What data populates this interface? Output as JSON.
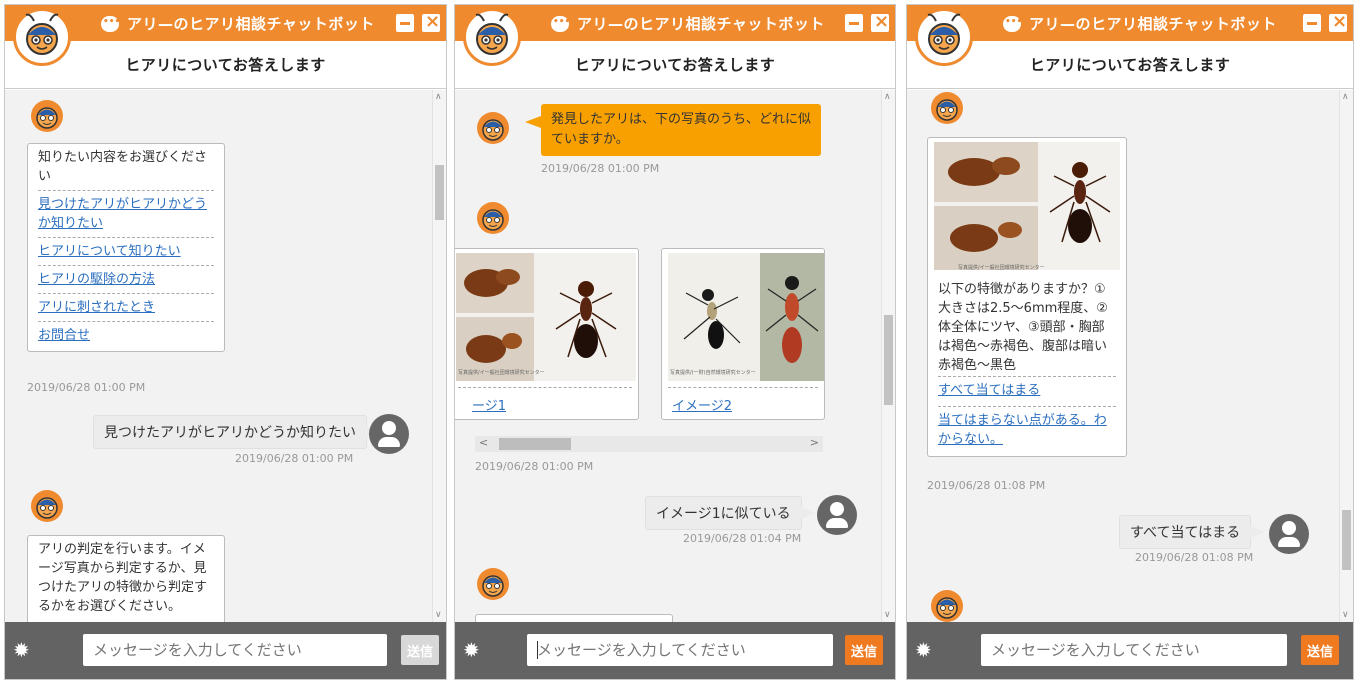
{
  "header": {
    "title": "アリ—のヒアリ相談チャットボット",
    "subtitle": "ヒアリについてお答えします"
  },
  "footer": {
    "placeholder": "メッセージを入力してください",
    "send_label": "送信"
  },
  "panel1": {
    "menu_card": {
      "prompt": "知りたい内容をお選びください",
      "options": [
        "見つけたアリがヒアリかどうか知りたい",
        "ヒアリについて知りたい",
        "ヒアリの駆除の方法",
        "アリに刺されたとき",
        "お問合せ"
      ]
    },
    "menu_time": "2019/06/28 01:00 PM",
    "user_msg": "見つけたアリがヒアリかどうか知りたい",
    "user_time": "2019/06/28 01:00 PM",
    "judge_text": "アリの判定を行います。イメージ写真から判定するか、見つけたアリの特徴から判定するかをお選びください。"
  },
  "panel2": {
    "question": "発見したアリは、下の写真のうち、どれに似ていますか。",
    "question_time": "2019/06/28 01:00 PM",
    "carousel": [
      {
        "link": "ージ1",
        "caption": "写真提供/イー般社団環境研究センター"
      },
      {
        "link": "イメージ2",
        "caption": "写真提供/(一財)自然環境研究センター"
      }
    ],
    "carousel_time": "2019/06/28 01:00 PM",
    "user_msg": "イメージ1に似ている",
    "user_time": "2019/06/28 01:04 PM"
  },
  "panel3": {
    "photo_caption": "写真提供/イー般社団環境研究センター",
    "features": "以下の特徴がありますか？①大きさは2.5〜6mm程度、②体全体にツヤ、③頭部・胸部は褐色〜赤褐色、腹部は暗い赤褐色〜黒色",
    "options": [
      "すべて当てはまる",
      "当てはまらない点がある。わからない。"
    ],
    "card_time": "2019/06/28 01:08 PM",
    "user_msg": "すべて当てはまる",
    "user_time": "2019/06/28 01:08 PM"
  },
  "colors": {
    "brand": "#ef8a2f",
    "send_active": "#ef7a20",
    "send_disabled": "#d8d8d8",
    "link": "#2b6fbf"
  }
}
